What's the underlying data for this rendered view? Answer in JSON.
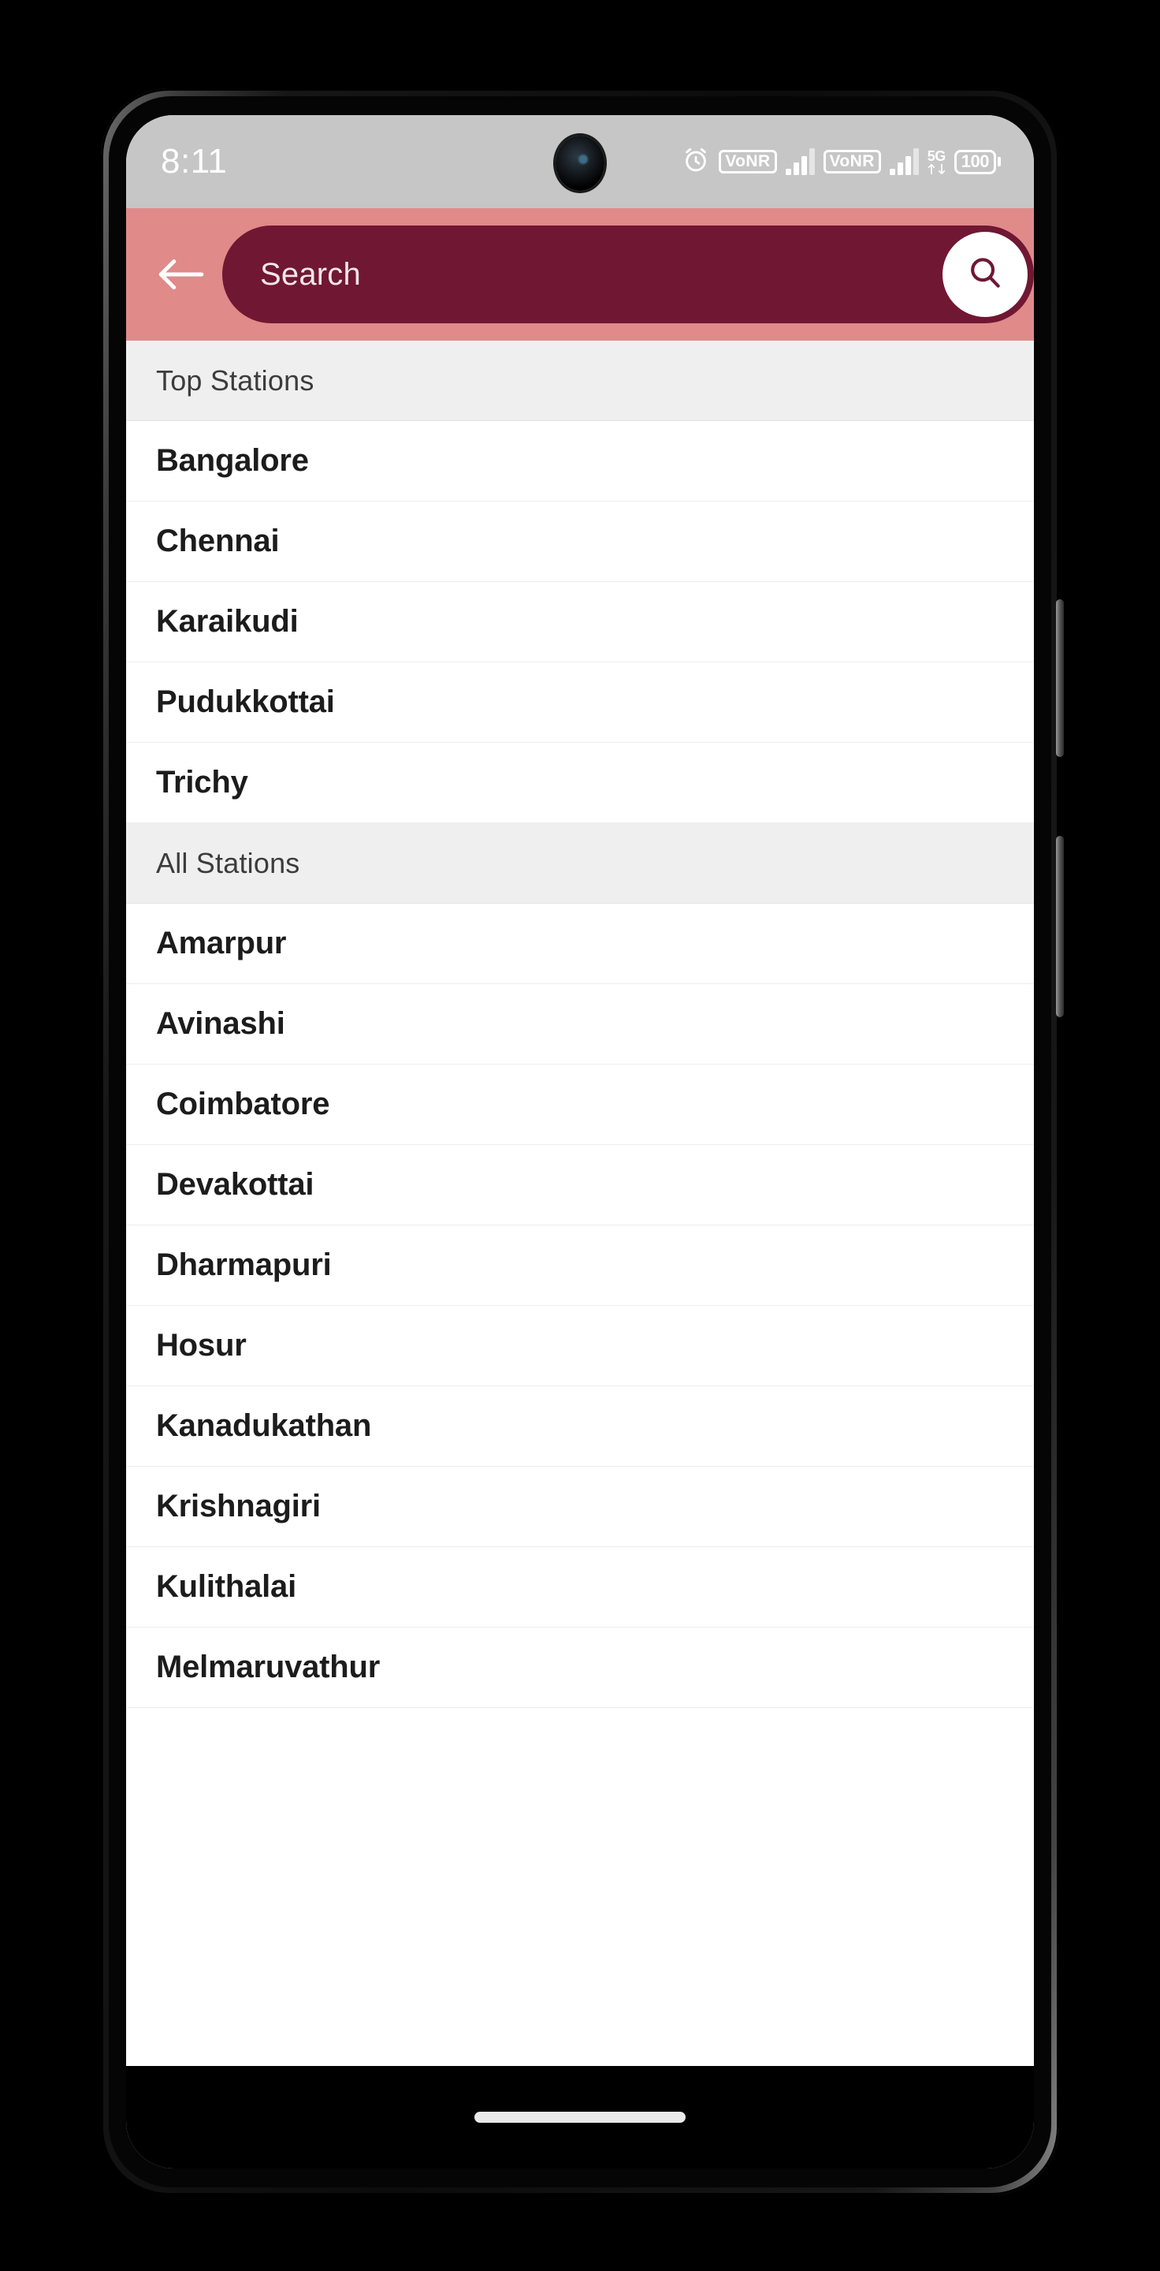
{
  "status_bar": {
    "time": "8:11",
    "alarm_icon": "alarm-clock-icon",
    "sim1_network_label": "VoNR",
    "sim2_network_label": "VoNR",
    "data_network_label": "5G",
    "battery_level": "100"
  },
  "header": {
    "back_icon": "back-arrow-icon",
    "search_placeholder": "Search",
    "search_value": "",
    "search_icon": "search-icon",
    "bg_color": "#e08a8a",
    "field_color": "#701733"
  },
  "sections": [
    {
      "title": "Top Stations",
      "items": [
        "Bangalore",
        "Chennai",
        "Karaikudi",
        "Pudukkottai",
        "Trichy"
      ]
    },
    {
      "title": "All Stations",
      "items": [
        "Amarpur",
        "Avinashi",
        "Coimbatore",
        "Devakottai",
        "Dharmapuri",
        "Hosur",
        "Kanadukathan",
        "Krishnagiri",
        "Kulithalai",
        "Melmaruvathur"
      ]
    }
  ],
  "nav_bar": {
    "gesture_pill": "home-gesture-pill"
  }
}
